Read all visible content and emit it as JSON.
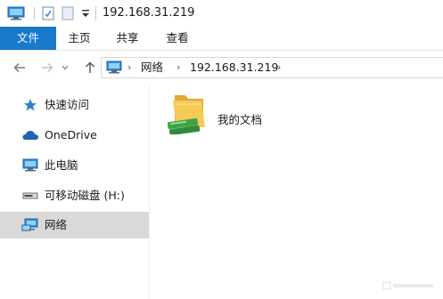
{
  "window": {
    "title": "192.168.31.219"
  },
  "ribbon": {
    "tabs": [
      {
        "label": "文件"
      },
      {
        "label": "主页"
      },
      {
        "label": "共享"
      },
      {
        "label": "查看"
      }
    ]
  },
  "address": {
    "crumbs": [
      {
        "label": "网络"
      },
      {
        "label": "192.168.31.219"
      }
    ]
  },
  "sidebar": {
    "items": [
      {
        "label": "快速访问",
        "icon": "star-icon"
      },
      {
        "label": "OneDrive",
        "icon": "cloud-icon"
      },
      {
        "label": "此电脑",
        "icon": "computer-icon"
      },
      {
        "label": "可移动磁盘 (H:)",
        "icon": "usb-drive-icon"
      },
      {
        "label": "网络",
        "icon": "network-icon",
        "selected": true
      }
    ]
  },
  "content": {
    "items": [
      {
        "label": "我的文档",
        "icon": "shared-folder-icon"
      }
    ]
  },
  "colors": {
    "accent": "#1979ca",
    "selected_bg": "#d9d9d9",
    "folder": "#f3c750",
    "share_green": "#3da548"
  }
}
